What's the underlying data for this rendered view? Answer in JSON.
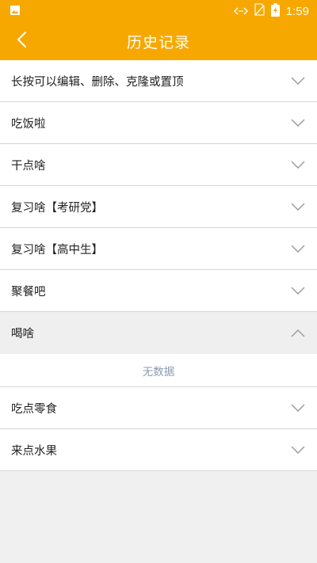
{
  "status_bar": {
    "time": "1:59",
    "icons": [
      "image-icon",
      "data-sync-icon",
      "no-sim-icon",
      "battery-charging-icon"
    ]
  },
  "app_bar": {
    "title": "历史记录",
    "back_icon": "chevron-left-icon"
  },
  "colors": {
    "accent": "#f7a800",
    "divider": "#d6d6d6",
    "empty_text": "#8a9bb0",
    "chevron": "#9a9a9a"
  },
  "list": {
    "rows": [
      {
        "label": "长按可以编辑、删除、克隆或置顶",
        "expanded": false
      },
      {
        "label": "吃饭啦",
        "expanded": false
      },
      {
        "label": "干点啥",
        "expanded": false
      },
      {
        "label": "复习啥【考研党】",
        "expanded": false
      },
      {
        "label": "复习啥【高中生】",
        "expanded": false
      },
      {
        "label": "聚餐吧",
        "expanded": false
      },
      {
        "label": "喝啥",
        "expanded": true,
        "empty_text": "无数据"
      },
      {
        "label": "吃点零食",
        "expanded": false
      },
      {
        "label": "来点水果",
        "expanded": false
      }
    ]
  }
}
